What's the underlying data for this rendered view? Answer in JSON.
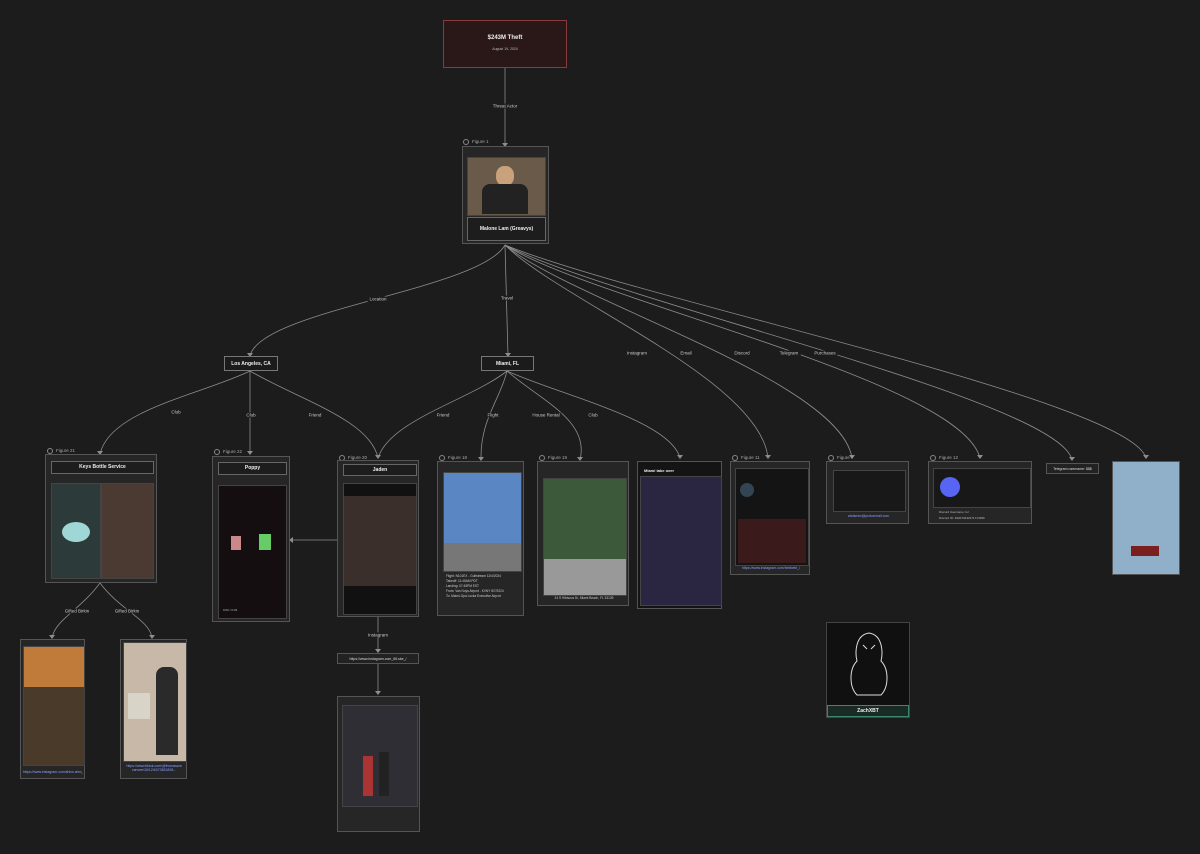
{
  "colors": {
    "background": "#1c1c1c",
    "root_border": "#8a3a3a",
    "link": "#8aa0ff",
    "zachxbt_border": "#3a8a70",
    "discord": "#5865f2"
  },
  "root": {
    "title": "$243M Theft",
    "date": "August 19, 2024"
  },
  "edges": {
    "threat_actor": "Threat Actor",
    "location": "Location",
    "travel": "Travel",
    "instagram": "Instagram",
    "email": "Email",
    "discord": "Discord",
    "telegram": "Telegram",
    "purchases": "Purchases",
    "la_club": "Club",
    "la_club2": "Club",
    "la_friend": "Friend",
    "mia_friend": "Friend",
    "mia_flight": "Flight",
    "mia_house": "House Rental",
    "mia_club": "Club",
    "gifted1": "Gifted Birkin",
    "gifted2": "Gifted Birkin",
    "jaden_instagram": "Instagram"
  },
  "subject": {
    "figure": "Figure 1",
    "name": "Malone Lam (Greavys)"
  },
  "locations": {
    "la": "Los Angeles, CA",
    "miami": "Miami, FL"
  },
  "figures": {
    "f21": {
      "label": "Figure 21",
      "title": "Keys Bottle Service"
    },
    "f22": {
      "label": "Figure 22",
      "title": "Poppy",
      "time": "0:00 / 0:04"
    },
    "f20": {
      "label": "Figure 20",
      "title": "Jaden",
      "link": "https://www.instagram.com_66.ske_/"
    },
    "f18": {
      "label": "Figure 18",
      "lines": [
        "Flight: N101EX - Gulfstream 12/4/2024",
        "Takeoff: 11:45AM PDT",
        "Landing: 07:45PM EST",
        "From: Van Nuys Airport - KVNY 8/7/2024",
        "To: Miami-Opa Locka Executive Airport"
      ]
    },
    "f19": {
      "label": "Figure 19",
      "address": "24 S Hibiscus Dr, Miami Beach, FL 33139"
    },
    "f_club": {
      "caption": "Miami take over"
    },
    "f11": {
      "label": "Figure 11",
      "link": "https://www.instagram.com/hebbebl_/"
    },
    "f7": {
      "label": "Figure 7",
      "link": "ahdsmkv@protonmail.com"
    },
    "f12": {
      "label": "Figure 12",
      "user_id": "Discord Username: lol",
      "discord_id": "Discord ID: 392070432371714696"
    },
    "telegram": {
      "text": "Telegram username: $$$"
    },
    "gift1": {
      "link": "https://www.instagram.com/shivs.ahm_/"
    },
    "gift2": {
      "link": "https://www.tiktok.com/@thomaswa\nvanvee/26/12/6373831808..."
    },
    "zachxbt": {
      "name": "ZachXBT"
    }
  }
}
